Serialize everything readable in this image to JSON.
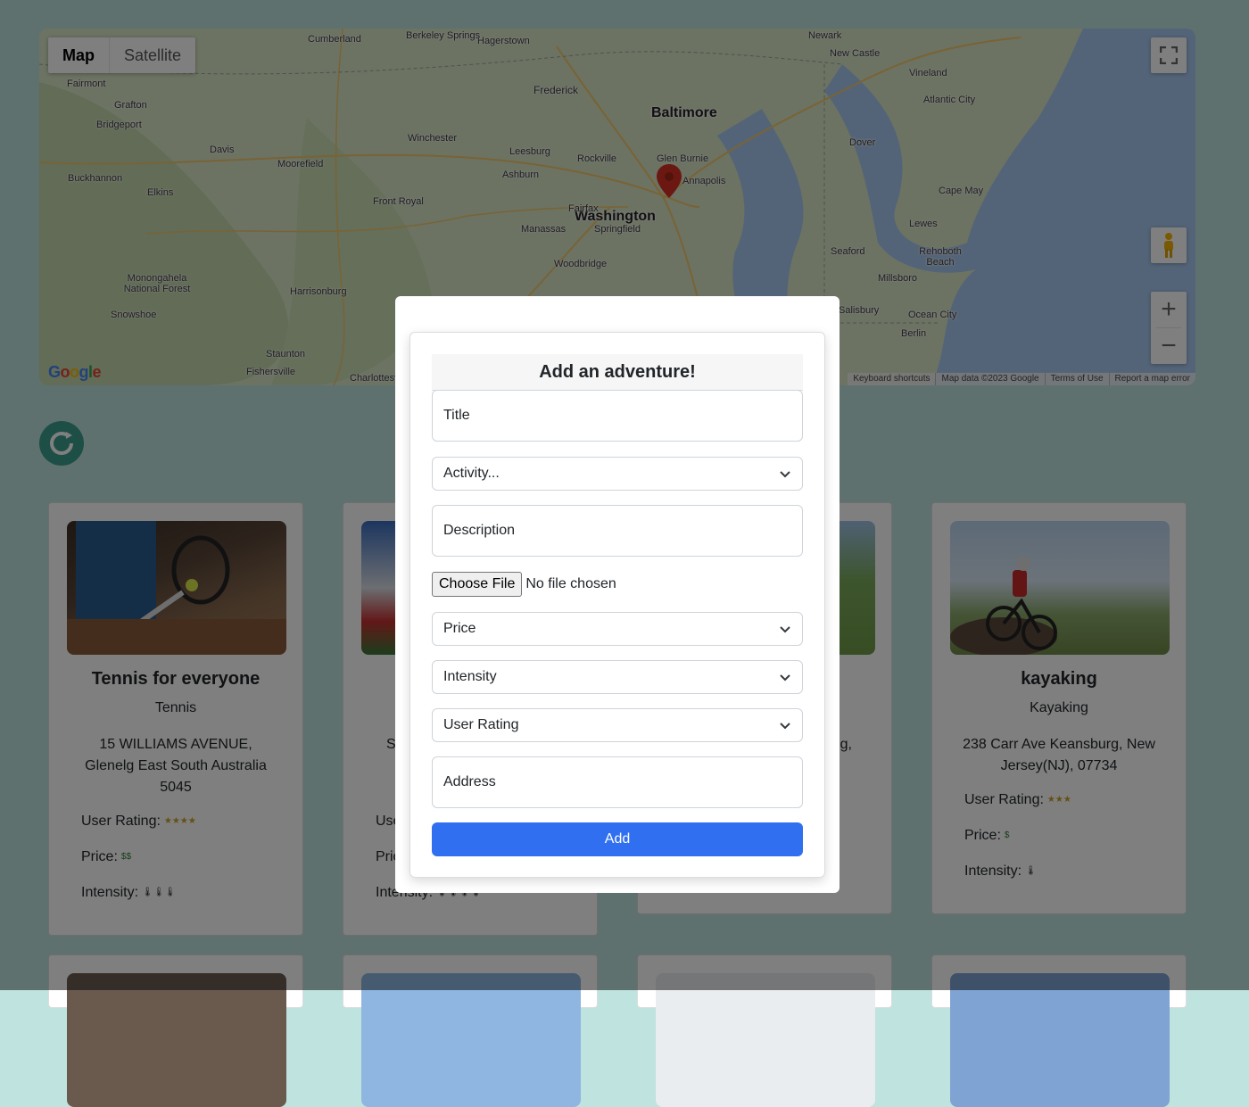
{
  "map": {
    "type_map": "Map",
    "type_satellite": "Satellite",
    "labels": [
      {
        "text": "Baltimore",
        "cls": "big"
      },
      {
        "text": "Washington",
        "cls": "big"
      },
      {
        "text": "Frederick",
        "cls": "mid"
      },
      {
        "text": "Hagerstown",
        "cls": ""
      },
      {
        "text": "Berkeley Springs",
        "cls": ""
      },
      {
        "text": "Cumberland",
        "cls": ""
      },
      {
        "text": "Newark",
        "cls": ""
      },
      {
        "text": "New Castle",
        "cls": ""
      },
      {
        "text": "Vineland",
        "cls": ""
      },
      {
        "text": "Atlantic City",
        "cls": ""
      },
      {
        "text": "Fairmont",
        "cls": ""
      },
      {
        "text": "Grafton",
        "cls": ""
      },
      {
        "text": "Bridgeport",
        "cls": ""
      },
      {
        "text": "Davis",
        "cls": ""
      },
      {
        "text": "Moorefield",
        "cls": ""
      },
      {
        "text": "Winchester",
        "cls": ""
      },
      {
        "text": "Leesburg",
        "cls": ""
      },
      {
        "text": "Rockville",
        "cls": ""
      },
      {
        "text": "Glen Burnie",
        "cls": ""
      },
      {
        "text": "Ashburn",
        "cls": ""
      },
      {
        "text": "Annapolis",
        "cls": ""
      },
      {
        "text": "Dover",
        "cls": ""
      },
      {
        "text": "Buckhannon",
        "cls": ""
      },
      {
        "text": "Elkins",
        "cls": ""
      },
      {
        "text": "Front Royal",
        "cls": ""
      },
      {
        "text": "Fairfax",
        "cls": ""
      },
      {
        "text": "Cape May",
        "cls": ""
      },
      {
        "text": "Manassas",
        "cls": ""
      },
      {
        "text": "Springfield",
        "cls": ""
      },
      {
        "text": "Lewes",
        "cls": ""
      },
      {
        "text": "Woodbridge",
        "cls": ""
      },
      {
        "text": "Seaford",
        "cls": ""
      },
      {
        "text": "Rehoboth Beach",
        "cls": ""
      },
      {
        "text": "Monongahela National Forest",
        "cls": ""
      },
      {
        "text": "Harrisonburg",
        "cls": ""
      },
      {
        "text": "Millsboro",
        "cls": ""
      },
      {
        "text": "Snowshoe",
        "cls": ""
      },
      {
        "text": "Salisbury",
        "cls": ""
      },
      {
        "text": "Ocean City",
        "cls": ""
      },
      {
        "text": "Berlin",
        "cls": ""
      },
      {
        "text": "Staunton",
        "cls": ""
      },
      {
        "text": "Fishersville",
        "cls": ""
      },
      {
        "text": "Charlottesville",
        "cls": ""
      }
    ],
    "attribution": [
      "Keyboard shortcuts",
      "Map data ©2023 Google",
      "Terms of Use",
      "Report a map error"
    ],
    "logo": "Google",
    "water_color": "#a8c8f0",
    "land_color": "#d8e6c5"
  },
  "cards": [
    {
      "title": "Tennis for everyone",
      "activity": "Tennis",
      "address": "15 WILLIAMS AVENUE, Glenelg East South Australia 5045",
      "rating_label": "User Rating:",
      "rating": "★★★★",
      "price_label": "Price:",
      "price": "$$",
      "intensity_label": "Intensity:",
      "intensity": "🌡🌡🌡"
    },
    {
      "title": "",
      "activity": "",
      "address": "S R",
      "rating_label": "Use",
      "rating": "",
      "price_label": "Pric",
      "price": "",
      "intensity_label": "Intensity:",
      "intensity": "🌡🌡🌡🌡"
    },
    {
      "title": "",
      "activity": "",
      "address": "g,",
      "rating_label": "",
      "rating": "",
      "price_label": "",
      "price": "",
      "intensity_label": "",
      "intensity": ""
    },
    {
      "title": "kayaking",
      "activity": "Kayaking",
      "address": "238 Carr Ave Keansburg, New Jersey(NJ), 07734",
      "rating_label": "User Rating:",
      "rating": "★★★",
      "price_label": "Price:",
      "price": "$",
      "intensity_label": "Intensity:",
      "intensity": "🌡"
    }
  ],
  "modal": {
    "heading": "Add an adventure!",
    "title_placeholder": "Title",
    "activity_select": "Activity...",
    "description_placeholder": "Description",
    "file_button": "Choose File",
    "file_status": "No file chosen",
    "price_select": "Price",
    "intensity_select": "Intensity",
    "rating_select": "User Rating",
    "address_placeholder": "Address",
    "submit": "Add"
  },
  "colors": {
    "accent": "#2f6ff0",
    "refresh": "#3d9e8f",
    "page_bg": "#bfe3df"
  }
}
